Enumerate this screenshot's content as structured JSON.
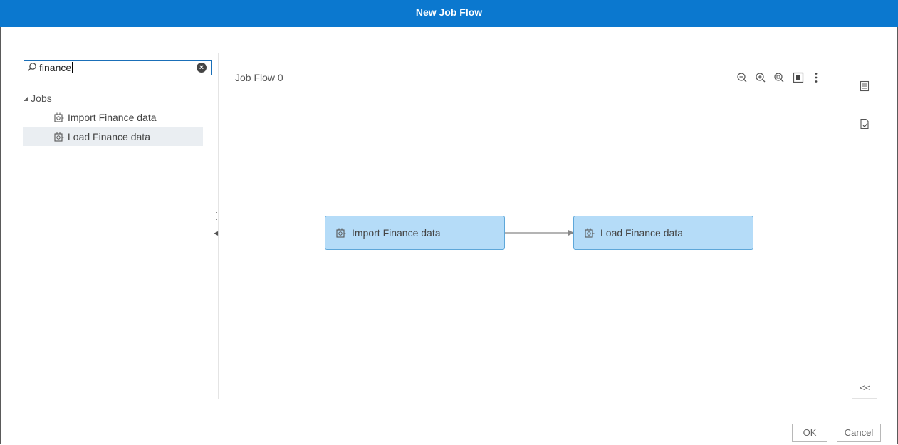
{
  "dialog": {
    "title": "New Job Flow"
  },
  "search": {
    "value": "finance",
    "clear_icon": "clear-circle-icon",
    "search_icon": "search-icon"
  },
  "tree": {
    "group_label": "Jobs",
    "items": [
      {
        "label": "Import Finance data",
        "icon": "job-icon",
        "selected": false
      },
      {
        "label": "Load Finance data",
        "icon": "job-icon",
        "selected": true
      }
    ]
  },
  "canvas": {
    "flow_title": "Job Flow 0",
    "toolbar": [
      "zoom-out-icon",
      "zoom-in-icon",
      "zoom-fit-icon",
      "overview-icon",
      "more-options-icon"
    ],
    "nodes": [
      {
        "label": "Import Finance data",
        "icon": "job-icon"
      },
      {
        "label": "Load Finance data",
        "icon": "job-icon"
      }
    ]
  },
  "rail": {
    "icons": [
      "properties-icon",
      "job-check-icon"
    ],
    "collapse_glyph": "<<"
  },
  "buttons": {
    "ok": "OK",
    "cancel": "Cancel"
  }
}
